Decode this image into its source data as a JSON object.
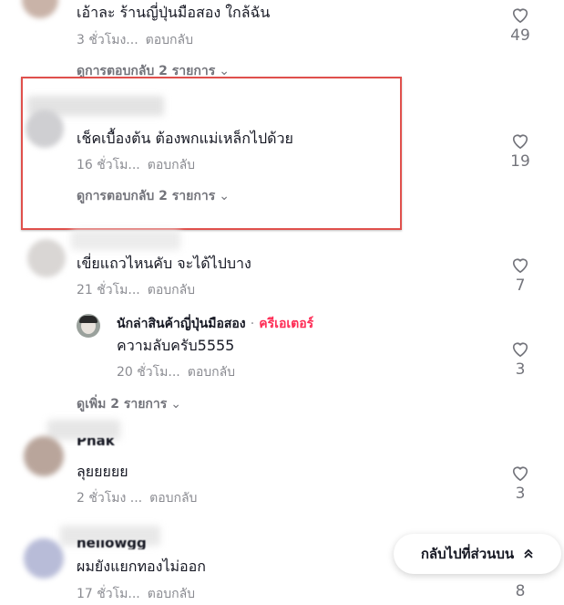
{
  "comments": [
    {
      "text": "เอ้าละ ร้านญี่ปุ่นมือสอง ใกล้ฉัน",
      "time": "3 ชั่วโมง...",
      "reply": "ตอบกลับ",
      "likes": "49",
      "more": "ดูการตอบกลับ 2 รายการ"
    },
    {
      "text": "เช็คเบื้องต้น ต้องพกแม่เหล็กไปด้วย",
      "time": "16 ชั่วโม...",
      "reply": "ตอบกลับ",
      "likes": "19",
      "more": "ดูการตอบกลับ 2 รายการ"
    },
    {
      "text": "เขี่ยแถวไหนคับ จะได้ไปบาง",
      "time": "21 ชั่วโม...",
      "reply": "ตอบกลับ",
      "likes": "7",
      "more": "ดูเพิ่ม 2 รายการ"
    },
    {
      "name": "Phak",
      "text": "ลุยยยยย",
      "time": "2 ชั่วโมง ...",
      "reply": "ตอบกลับ",
      "likes": "3"
    },
    {
      "name": "hellowgg",
      "text": "ผมยังแยกทองไม่ออก",
      "time": "17 ชั่วโม...",
      "reply": "ตอบกลับ",
      "likes": "8"
    }
  ],
  "creator_reply": {
    "name": "นักล่าสินค้าญี่ปุ่นมือสอง",
    "separator": "·",
    "tag": "ครีเอเตอร์",
    "text": "ความลับครับ5555",
    "time": "20 ชั่วโม...",
    "reply": "ตอบกลับ",
    "likes": "3"
  },
  "back_to_top": "กลับไปที่ส่วนบน",
  "colors": {
    "accent": "#fe2c55",
    "highlight": "#e0504c"
  }
}
